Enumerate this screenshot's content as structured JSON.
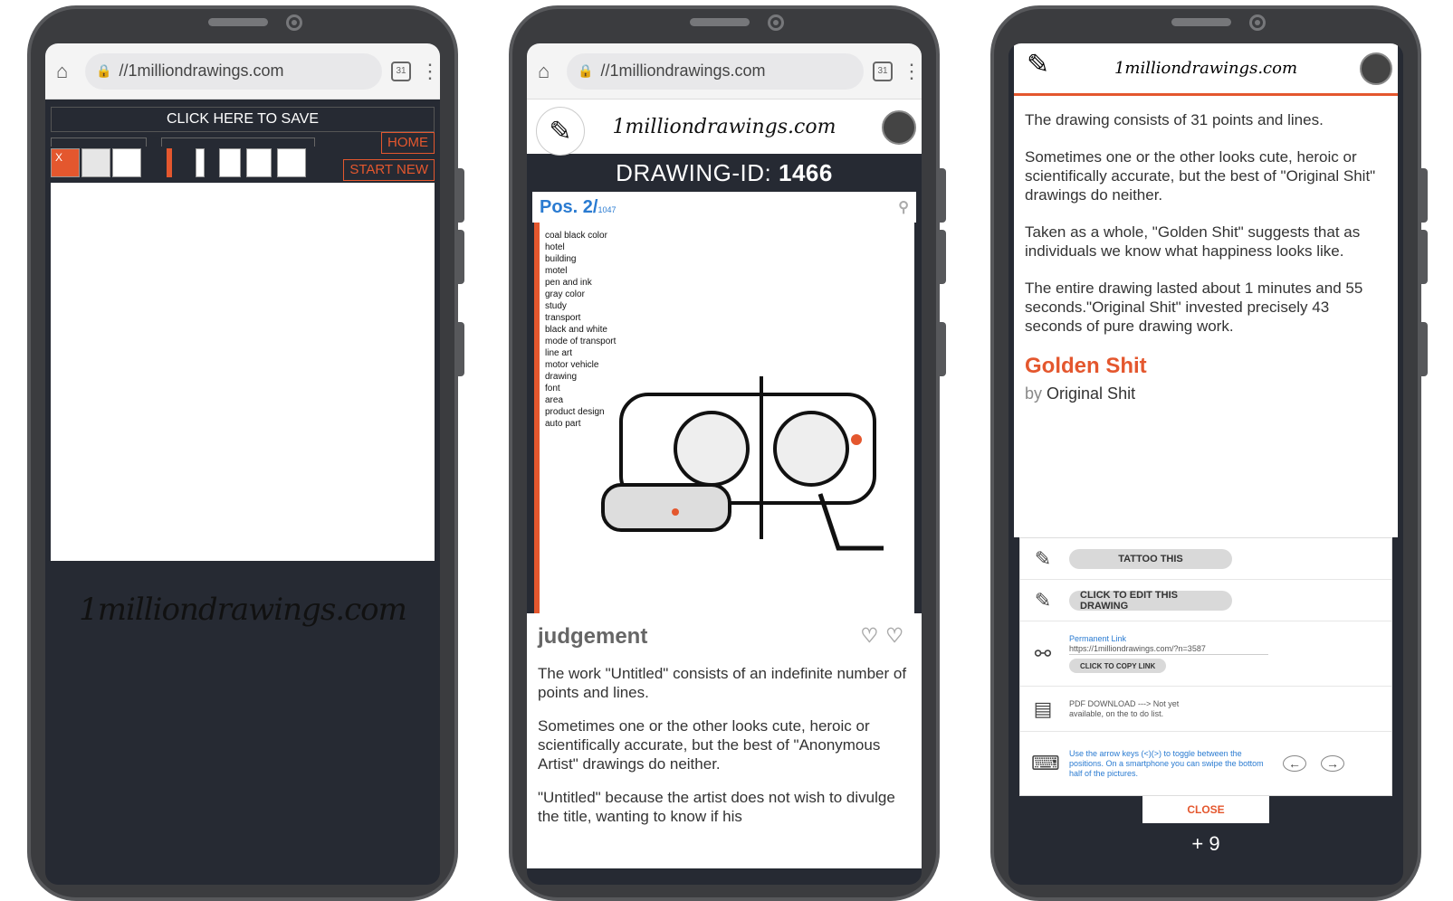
{
  "browser": {
    "url": "//1milliondrawings.com",
    "tabs_count": "31"
  },
  "phone1": {
    "save_label": "CLICK HERE TO SAVE",
    "color_label": "",
    "line_label": "",
    "close_label": "X",
    "home_label": "HOME",
    "start_new_label": "START NEW",
    "logo_text": "1milliondrawings.com"
  },
  "phone2": {
    "logo_text": "1milliondrawings.com",
    "drawing_id_label": "DRAWING-ID:",
    "drawing_id": "1466",
    "pos_label": "Pos. 2/",
    "pos_total": "1047",
    "tags": [
      "coal black color",
      "hotel",
      "building",
      "motel",
      "pen and ink",
      "gray color",
      "study",
      "transport",
      "black and white",
      "mode of transport",
      "line art",
      "motor vehicle",
      "drawing",
      "font",
      "area",
      "product design",
      "auto part"
    ],
    "judgement_title": "judgement",
    "paragraphs": [
      "The work \"Untitled\" consists of an indefinite number of points and lines.",
      "Sometimes one or the other looks cute, heroic or scientifically accurate, but the best of \"Anonymous Artist\" drawings do neither.",
      "\"Untitled\" because the artist does not wish to divulge the title, wanting to know if his"
    ]
  },
  "phone3": {
    "logo_text": "1milliondrawings.com",
    "paragraphs": [
      "The drawing consists of 31 points and lines.",
      "Sometimes one or the other looks cute, heroic or scientifically accurate, but the best of \"Original Shit\" drawings do neither.",
      "Taken as a whole, \"Golden Shit\" suggests that as individuals we know what happiness looks like.",
      "The entire drawing lasted about 1 minutes and 55 seconds.\"Original Shit\" invested precisely 43 seconds of pure drawing work."
    ],
    "title": "Golden Shit",
    "by_prefix": "by",
    "artist": "Original Shit",
    "tattoo_label": "TATTOO THIS",
    "edit_label": "CLICK TO EDIT THIS DRAWING",
    "permalink_label": "Permanent Link",
    "permalink_url": "https://1milliondrawings.com/?n=3587",
    "copy_label": "CLICK TO COPY LINK",
    "pdf_text": "PDF DOWNLOAD ---> Not yet available, on the to do list.",
    "nav_text": "Use the arrow keys (<)(>) to toggle between the positions. On a smartphone you can swipe the bottom half of the pictures.",
    "close_label": "CLOSE",
    "plus_label": "+ 9"
  },
  "colors": {
    "accent": "#e4572e",
    "link": "#2a7bd1",
    "dark": "#262a33"
  }
}
